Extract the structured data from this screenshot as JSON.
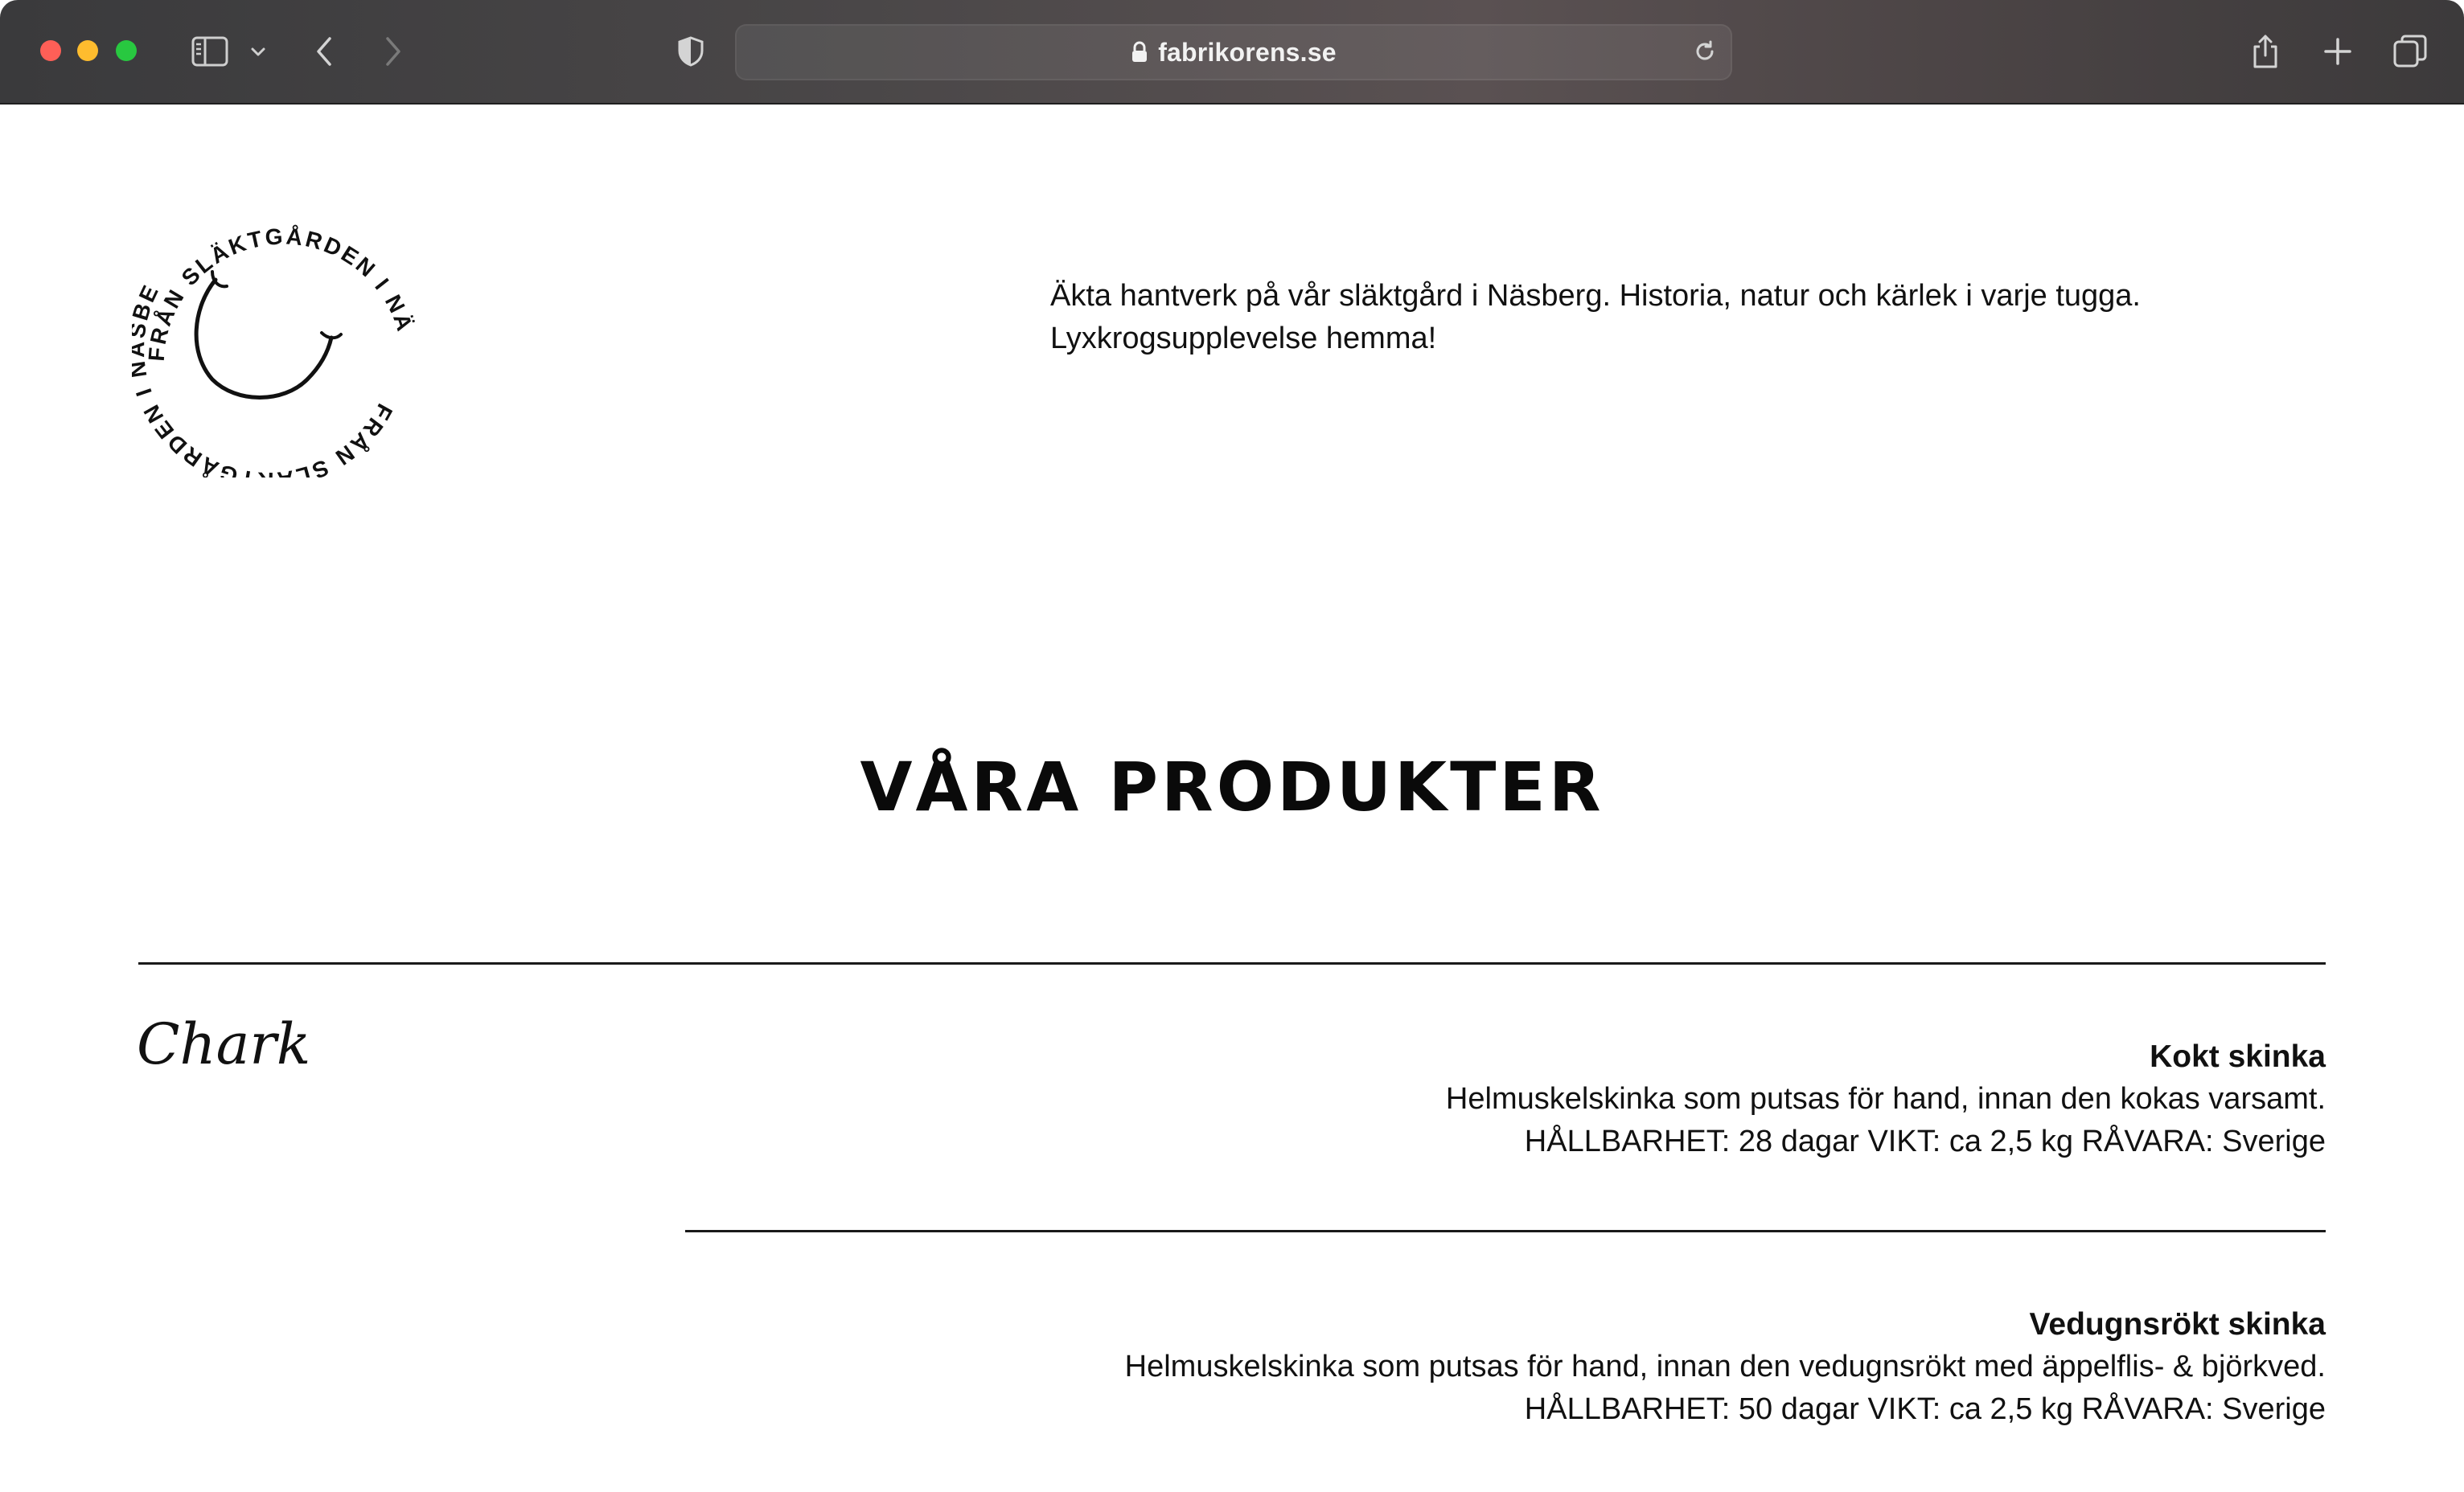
{
  "browser": {
    "url": "fabrikorens.se"
  },
  "logo": {
    "ring_text_top": "FRÅN SLÄKTGÅRDEN I NÄSBERG",
    "ring_text_bottom": "FRÅN SLÄKTGÅRDEN I NÄSBERG"
  },
  "intro": {
    "line1": "Äkta hantverk på vår släktgård i Näsberg. Historia, natur och kärlek i varje tugga.",
    "line2": "Lyxkrogsupplevelse hemma!"
  },
  "section": {
    "heading": "VÅRA PRODUKTER",
    "category": "Chark"
  },
  "products": [
    {
      "name": "Kokt skinka",
      "description": "Helmuskelskinka som putsas för hand, innan den kokas varsamt.",
      "meta": "HÅLLBARHET: 28 dagar VIKT: ca 2,5 kg RÅVARA: Sverige"
    },
    {
      "name": "Vedugnsrökt skinka",
      "description": "Helmuskelskinka som putsas för hand, innan den vedugnsrökt med äppelflis- & björkved.",
      "meta": "HÅLLBARHET: 50 dagar VIKT: ca 2,5 kg RÅVARA: Sverige"
    }
  ],
  "icons": {
    "sidebar": "sidebar-icon",
    "chevron": "chevron-down-icon",
    "back": "back-arrow-icon",
    "forward": "forward-arrow-icon",
    "privacy": "shield-icon",
    "lock": "lock-icon",
    "reload": "reload-icon",
    "share": "share-icon",
    "new_tab": "plus-icon",
    "tabs": "tab-overview-icon"
  }
}
